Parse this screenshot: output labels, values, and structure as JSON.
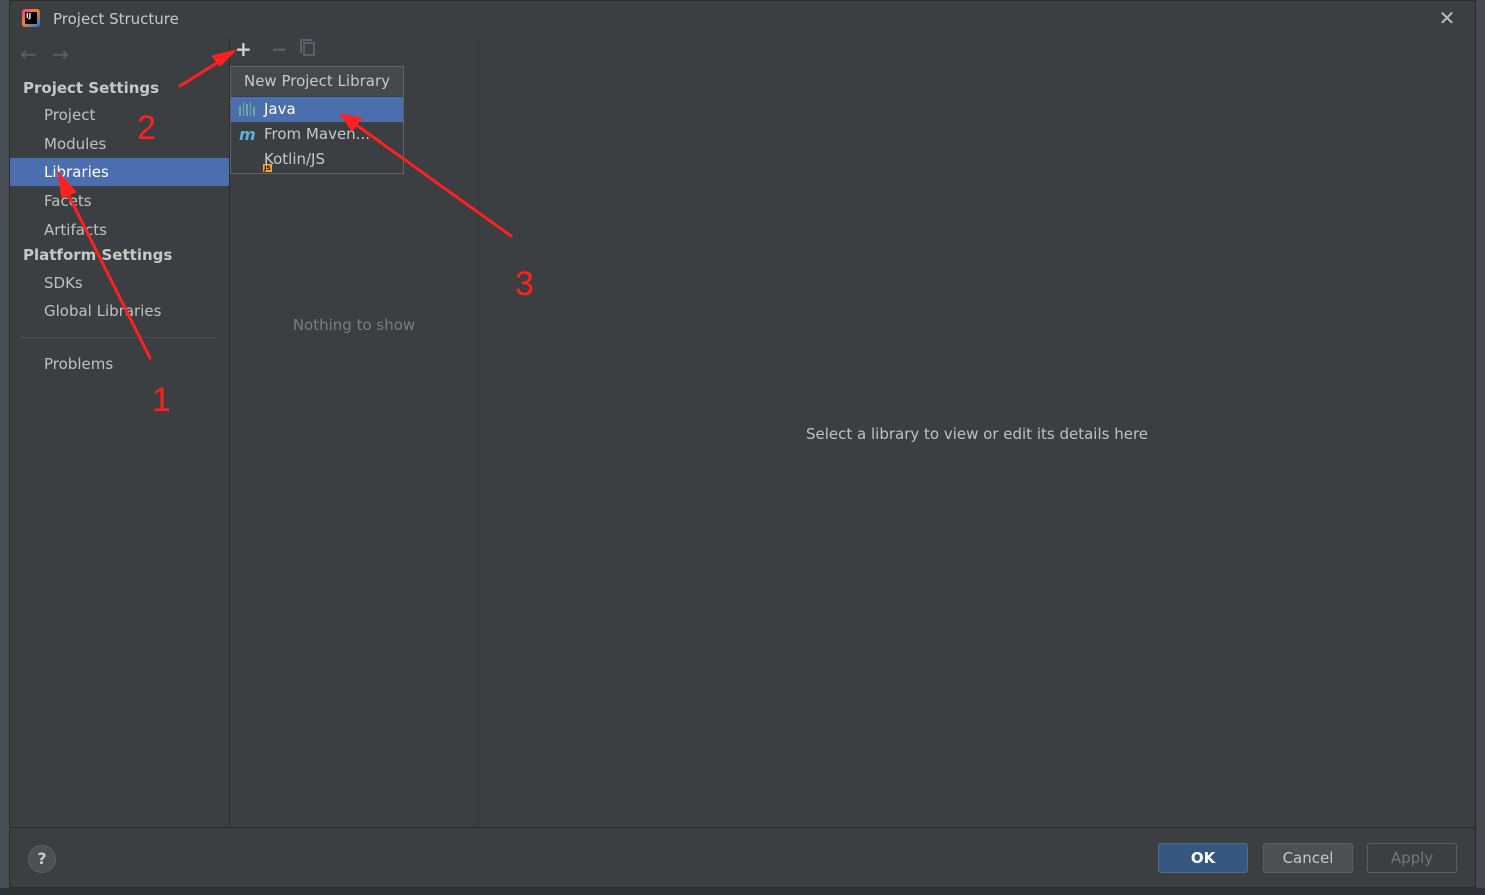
{
  "window": {
    "title": "Project Structure",
    "close": "✕"
  },
  "nav": {
    "back": "←",
    "forward": "→"
  },
  "sidebar": {
    "project_settings_title": "Project Settings",
    "platform_settings_title": "Platform Settings",
    "items": [
      {
        "label": "Project"
      },
      {
        "label": "Modules"
      },
      {
        "label": "Libraries",
        "selected": true
      },
      {
        "label": "Facets"
      },
      {
        "label": "Artifacts"
      },
      {
        "label": "SDKs"
      },
      {
        "label": "Global Libraries"
      },
      {
        "label": "Problems"
      }
    ]
  },
  "toolbar": {
    "add": "+",
    "remove": "−"
  },
  "middle": {
    "empty_text": "Nothing to show"
  },
  "popup": {
    "title": "New Project Library",
    "items": [
      {
        "label": "Java",
        "icon": "java-library-icon",
        "selected": true
      },
      {
        "label": "From Maven...",
        "icon": "maven-icon"
      },
      {
        "label": "Kotlin/JS",
        "icon": "kotlin-js-icon"
      }
    ]
  },
  "details": {
    "placeholder": "Select a library to view or edit its details here"
  },
  "footer": {
    "help": "?",
    "ok": "OK",
    "cancel": "Cancel",
    "apply": "Apply"
  },
  "annotations": {
    "step1": "1",
    "step2": "2",
    "step3": "3"
  },
  "colors": {
    "selection": "#4b6eaf",
    "ok_button": "#365880",
    "annotation": "#ff2020"
  }
}
